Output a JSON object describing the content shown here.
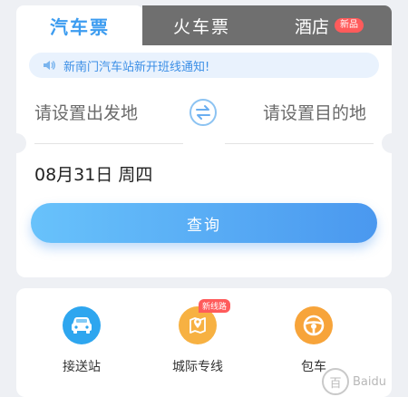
{
  "tabs": {
    "bus_ticket": "汽车票",
    "train_ticket": "火车票",
    "hotel": "酒店",
    "hotel_badge": "新品"
  },
  "notice": {
    "text": "新南门汽车站新开班线通知!",
    "icon": "speaker-icon"
  },
  "route": {
    "from_placeholder": "请设置出发地",
    "to_placeholder": "请设置目的地",
    "swap_icon": "swap-icon"
  },
  "date": {
    "value": "08月31日 周四"
  },
  "search": {
    "label": "查询"
  },
  "services": [
    {
      "label": "接送站",
      "icon": "car-icon",
      "color": "#2ea6ef"
    },
    {
      "label": "城际专线",
      "icon": "map-pin-icon",
      "color": "#f7b142",
      "badge": "新线路"
    },
    {
      "label": "包车",
      "icon": "steering-wheel-icon",
      "color": "#f7a43a"
    }
  ],
  "watermark": {
    "text": "Baidu"
  },
  "colors": {
    "accent": "#3c9cf0",
    "tab_inactive": "#6f6f6f",
    "badge": "#ff5b5b"
  }
}
